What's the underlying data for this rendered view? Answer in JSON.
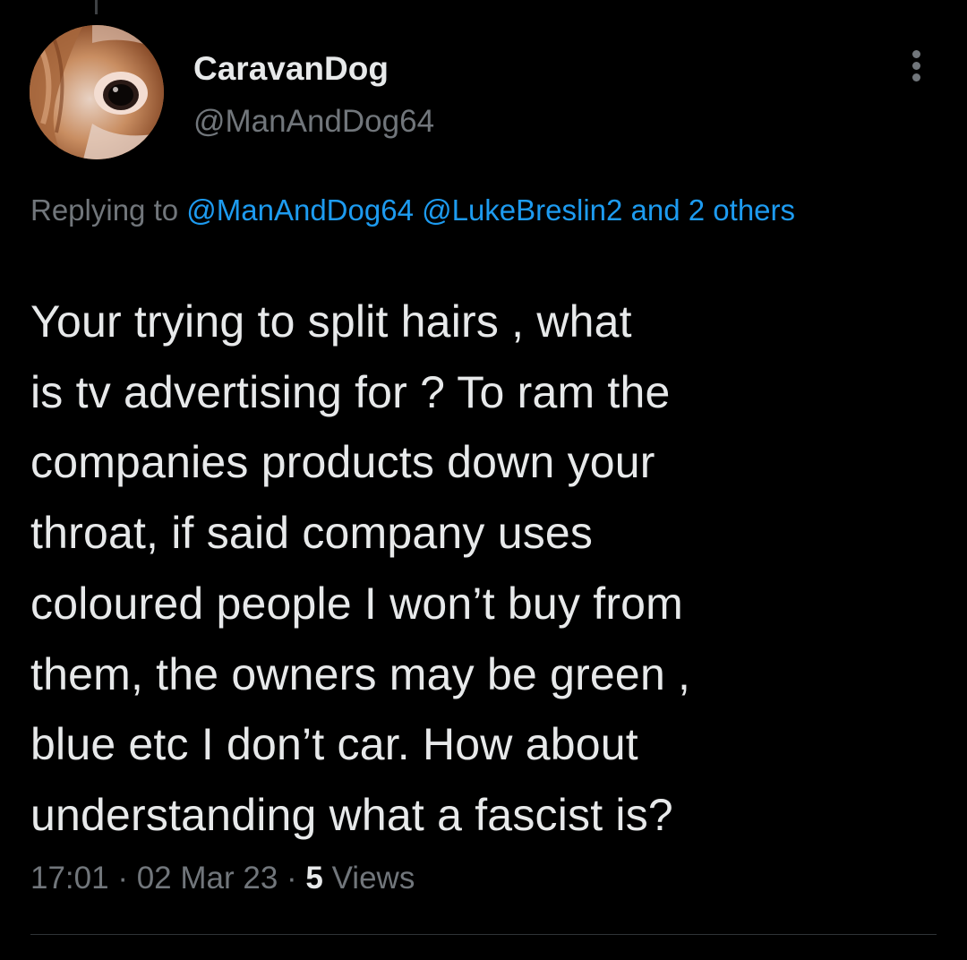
{
  "author": {
    "display_name": "CaravanDog",
    "handle": "@ManAndDog64",
    "avatar_icon": "dog-photo-avatar"
  },
  "reply": {
    "prefix": "Replying to ",
    "mentions": [
      "@ManAndDog64",
      "@LukeBreslin2"
    ],
    "others_text": "and 2 others"
  },
  "tweet": {
    "lines": [
      "Your trying to split hairs , what",
      "is tv advertising for ? To ram the",
      "companies products down your",
      "throat, if said company uses",
      "coloured people I won’t buy from",
      "them, the owners may be green ,",
      "blue etc I don’t car. How about",
      "understanding what a fascist is?"
    ]
  },
  "meta": {
    "time": "17:01",
    "separator": " · ",
    "date": "02 Mar 23",
    "views_count": "5",
    "views_label": " Views"
  },
  "colors": {
    "background": "#000000",
    "primary_text": "#e7e9ea",
    "secondary_text": "#71767b",
    "link": "#1d9bf0",
    "divider": "#2f3336"
  },
  "icons": {
    "more": "more-vertical-icon"
  }
}
